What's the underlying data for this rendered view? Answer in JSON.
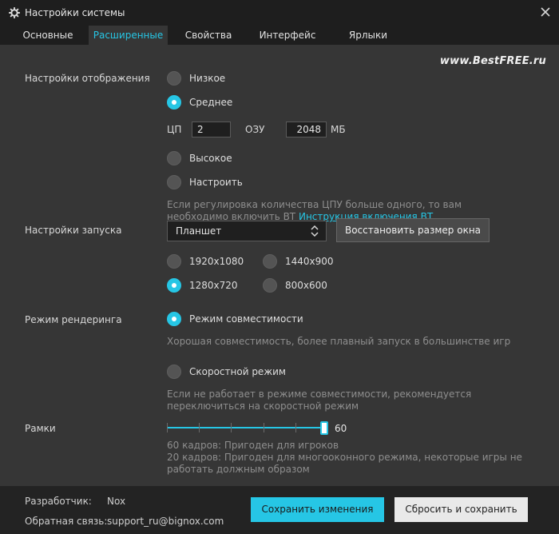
{
  "window": {
    "title": "Настройки системы"
  },
  "tabs": [
    {
      "label": "Основные"
    },
    {
      "label": "Расширенные",
      "active": true
    },
    {
      "label": "Свойства"
    },
    {
      "label": "Интерфейс"
    },
    {
      "label": "Ярлыки"
    }
  ],
  "watermark": "www.BestFREE.ru",
  "display": {
    "label": "Настройки отображения",
    "options": {
      "low": "Низкое",
      "medium": "Среднее",
      "high": "Высокое",
      "custom": "Настроить"
    },
    "selected": "Среднее",
    "cpu_label": "ЦП",
    "cpu_value": "2",
    "ram_label": "ОЗУ",
    "ram_value": "2048",
    "ram_unit": "МБ",
    "hint_text": "Если регулировка количества ЦПУ больше одного, то вам необходимо включить ВТ",
    "hint_link": "Инструкция включения ВТ"
  },
  "startup": {
    "label": "Настройки запуска",
    "device_value": "Планшет",
    "restore_button": "Восстановить размер окна",
    "resolutions": {
      "r1": "1920x1080",
      "r2": "1440x900",
      "r3": "1280x720",
      "r4": "800x600"
    },
    "selected": "1280x720"
  },
  "render": {
    "label": "Режим рендеринга",
    "compat": "Режим совместимости",
    "compat_hint": "Хорошая совместимость, более плавный запуск в большинстве игр",
    "speed": "Скоростной режим",
    "speed_hint": "Если не работает в режиме совместимости, рекомендуется переключиться на скоростной режим",
    "selected": "Режим совместимости"
  },
  "frames": {
    "label": "Рамки",
    "value": "60",
    "hint_line1": "60 кадров: Пригоден для игроков",
    "hint_line2": "20 кадров: Пригоден для многооконного режима, некоторые игры не работать должным образом"
  },
  "footer": {
    "developer_label": "Разработчик:",
    "developer_value": "Nox",
    "feedback_label": "Обратная связь:",
    "feedback_value": "support_ru@bignox.com",
    "save_button": "Сохранить изменения",
    "reset_button": "Сбросить и сохранить"
  },
  "colors": {
    "accent": "#26c6e5",
    "bg_panel": "#363636",
    "bg_dark": "#232323"
  },
  "icons": {
    "app": "gear-icon",
    "close": "close-icon",
    "select": "chevron-updown-icon"
  }
}
